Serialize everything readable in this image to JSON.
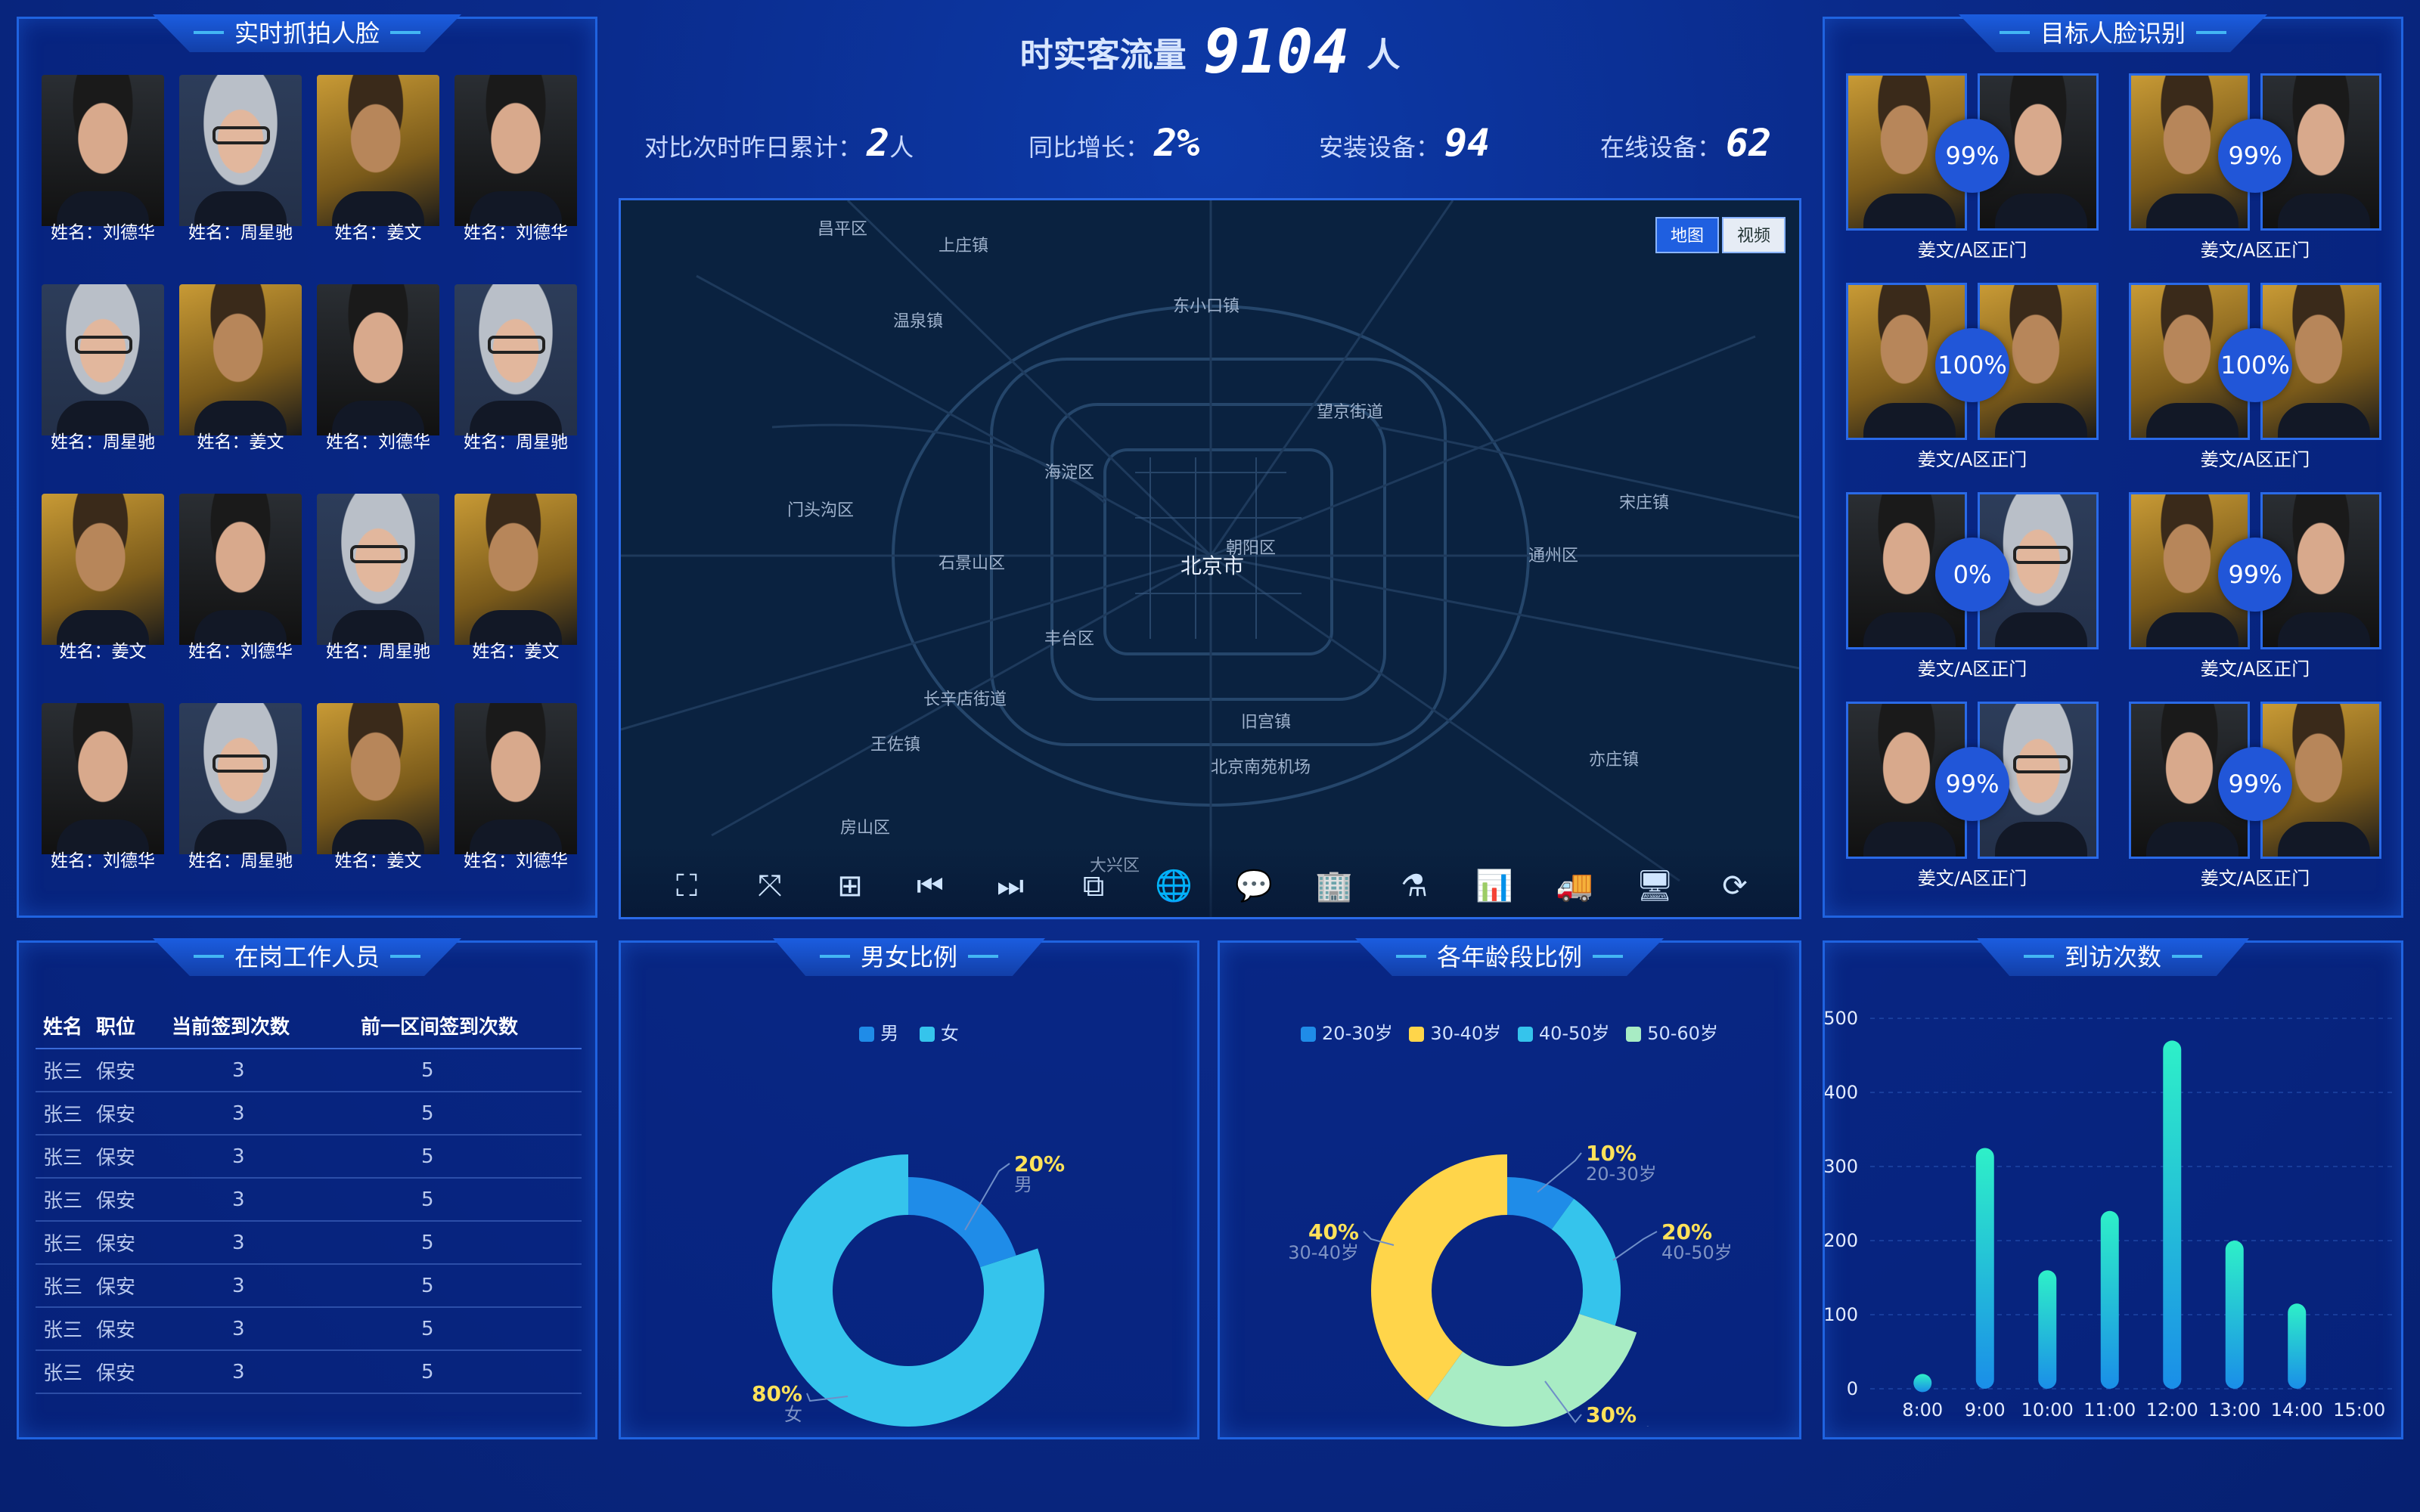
{
  "header": {
    "title": "时实客流量",
    "count": "9104",
    "unit": "人",
    "stats": [
      {
        "label": "对比次时昨日累计：",
        "value": "2",
        "unit": "人"
      },
      {
        "label": "同比增长：",
        "value": "2%",
        "unit": ""
      },
      {
        "label": "安装设备：",
        "value": "94",
        "unit": ""
      },
      {
        "label": "在线设备：",
        "value": "62",
        "unit": ""
      }
    ]
  },
  "capture": {
    "title": "实时抓拍人脸",
    "faces": [
      {
        "name": "姓名：刘德华",
        "p": "liu"
      },
      {
        "name": "姓名：周星驰",
        "p": "zhou"
      },
      {
        "name": "姓名：姜文",
        "p": "jiang"
      },
      {
        "name": "姓名：刘德华",
        "p": "liu"
      },
      {
        "name": "姓名：周星驰",
        "p": "zhou"
      },
      {
        "name": "姓名：姜文",
        "p": "jiang"
      },
      {
        "name": "姓名：刘德华",
        "p": "liu"
      },
      {
        "name": "姓名：周星驰",
        "p": "zhou"
      },
      {
        "name": "姓名：姜文",
        "p": "jiang"
      },
      {
        "name": "姓名：刘德华",
        "p": "liu"
      },
      {
        "name": "姓名：周星驰",
        "p": "zhou"
      },
      {
        "name": "姓名：姜文",
        "p": "jiang"
      },
      {
        "name": "姓名：刘德华",
        "p": "liu"
      },
      {
        "name": "姓名：周星驰",
        "p": "zhou"
      },
      {
        "name": "姓名：姜文",
        "p": "jiang"
      },
      {
        "name": "姓名：刘德华",
        "p": "liu"
      }
    ]
  },
  "target": {
    "title": "目标人脸识别",
    "items": [
      {
        "a": "jiang",
        "b": "liu",
        "pct": "99%",
        "loc": "姜文/A区正门"
      },
      {
        "a": "jiang",
        "b": "liu",
        "pct": "99%",
        "loc": "姜文/A区正门"
      },
      {
        "a": "jiang",
        "b": "jiang",
        "pct": "100%",
        "loc": "姜文/A区正门"
      },
      {
        "a": "jiang",
        "b": "jiang",
        "pct": "100%",
        "loc": "姜文/A区正门"
      },
      {
        "a": "liu",
        "b": "zhou",
        "pct": "0%",
        "loc": "姜文/A区正门"
      },
      {
        "a": "jiang",
        "b": "liu",
        "pct": "99%",
        "loc": "姜文/A区正门"
      },
      {
        "a": "liu",
        "b": "zhou",
        "pct": "99%",
        "loc": "姜文/A区正门"
      },
      {
        "a": "liu",
        "b": "jiang",
        "pct": "99%",
        "loc": "姜文/A区正门"
      }
    ]
  },
  "map": {
    "btn_map": "地图",
    "btn_video": "视频",
    "places": [
      "昌平区",
      "北京市",
      "海淀区",
      "朝阳区",
      "丰台区",
      "石景山区",
      "门头沟区",
      "通州区",
      "大兴区",
      "房山区",
      "北京南苑机场",
      "上庄镇",
      "温泉镇",
      "东小口镇",
      "望京街道",
      "王佐镇",
      "长辛店街道",
      "旧宫镇",
      "亦庄镇",
      "宋庄镇"
    ]
  },
  "staff": {
    "title": "在岗工作人员",
    "headers": [
      "姓名",
      "职位",
      "当前签到次数",
      "前一区间签到次数"
    ],
    "rows": [
      [
        "张三",
        "保安",
        "3",
        "5"
      ],
      [
        "张三",
        "保安",
        "3",
        "5"
      ],
      [
        "张三",
        "保安",
        "3",
        "5"
      ],
      [
        "张三",
        "保安",
        "3",
        "5"
      ],
      [
        "张三",
        "保安",
        "3",
        "5"
      ],
      [
        "张三",
        "保安",
        "3",
        "5"
      ],
      [
        "张三",
        "保安",
        "3",
        "5"
      ],
      [
        "张三",
        "保安",
        "3",
        "5"
      ]
    ]
  },
  "gender": {
    "title": "男女比例",
    "legend": [
      "男",
      "女"
    ],
    "colors": [
      "#1f8ce8",
      "#35c4ec"
    ],
    "labels": [
      {
        "pct": "20%",
        "name": "男"
      },
      {
        "pct": "80%",
        "name": "女"
      }
    ]
  },
  "age": {
    "title": "各年龄段比例",
    "legend": [
      "20-30岁",
      "30-40岁",
      "40-50岁",
      "50-60岁"
    ],
    "colors": [
      "#1f8ce8",
      "#ffd54a",
      "#35c4ec",
      "#a8ecc4"
    ],
    "labels": [
      {
        "pct": "10%",
        "name": "20-30岁"
      },
      {
        "pct": "20%",
        "name": "40-50岁"
      },
      {
        "pct": "30%",
        "name": "50-60岁"
      },
      {
        "pct": "40%",
        "name": "30-40岁"
      }
    ]
  },
  "visits": {
    "title": "到访次数",
    "yticks": [
      "0",
      "100",
      "200",
      "300",
      "400",
      "500"
    ]
  },
  "chart_data": [
    {
      "type": "pie",
      "title": "男女比例",
      "categories": [
        "男",
        "女"
      ],
      "values": [
        20,
        80
      ]
    },
    {
      "type": "pie",
      "title": "各年龄段比例",
      "categories": [
        "20-30岁",
        "30-40岁",
        "40-50岁",
        "50-60岁"
      ],
      "values": [
        10,
        40,
        20,
        30
      ]
    },
    {
      "type": "bar",
      "title": "到访次数",
      "categories": [
        "8:00",
        "9:00",
        "10:00",
        "11:00",
        "12:00",
        "13:00",
        "14:00",
        "15:00"
      ],
      "values": [
        20,
        325,
        160,
        240,
        470,
        200,
        115,
        0
      ],
      "ylim": [
        0,
        500
      ]
    }
  ]
}
